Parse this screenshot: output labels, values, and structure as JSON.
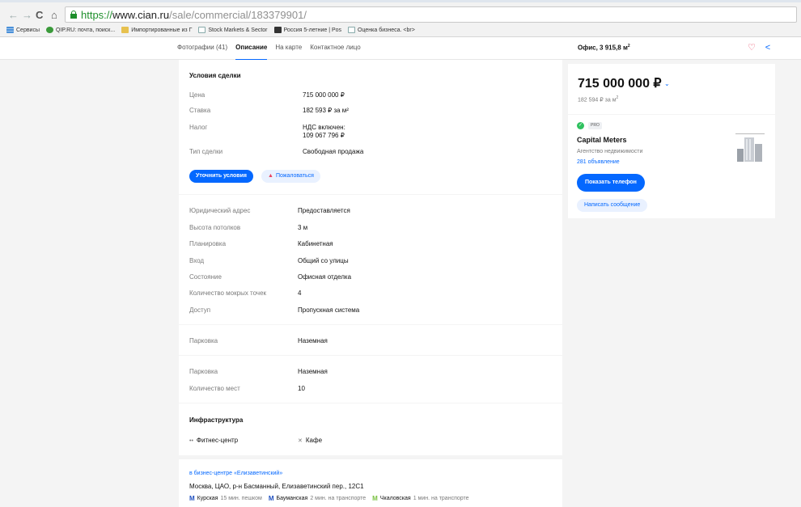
{
  "browser": {
    "url_protocol": "https://",
    "url_host": "www.cian.ru",
    "url_path": "/sale/commercial/183379901/",
    "bookmarks": [
      {
        "label": "Сервисы",
        "icon": "apps-icon"
      },
      {
        "label": "QIP.RU: почта, поиск...",
        "icon": "qip-icon"
      },
      {
        "label": "Импортированные из Г",
        "icon": "folder-icon"
      },
      {
        "label": "Stock Markets & Sector",
        "icon": "page-icon"
      },
      {
        "label": "Россия 5-летние | Pos",
        "icon": "ru-icon"
      },
      {
        "label": "Оценка бизнеса. <br>",
        "icon": "page-icon"
      }
    ]
  },
  "header": {
    "tabs": [
      "Фотографии (41)",
      "Описание",
      "На карте",
      "Контактное лицо"
    ],
    "active_tab_index": 1,
    "title": "Офис, 3 915,8 м",
    "title_sup": "2"
  },
  "conditions": {
    "title": "Условия сделки",
    "rows": [
      {
        "label": "Цена",
        "value": "715 000 000 ₽"
      },
      {
        "label": "Ставка",
        "value": "182 593 ₽ за м²"
      },
      {
        "label": "Налог",
        "value": "НДС включен:",
        "value2": "109 067 796 ₽"
      },
      {
        "label": "Тип сделки",
        "value": "Свободная продажа"
      }
    ],
    "clarify_button": "Уточнить условия",
    "complain_button": "Пожаловаться"
  },
  "params": [
    {
      "label": "Юридический адрес",
      "value": "Предоставляется"
    },
    {
      "label": "Высота потолков",
      "value": "3 м"
    },
    {
      "label": "Планировка",
      "value": "Кабинетная"
    },
    {
      "label": "Вход",
      "value": "Общий со улицы"
    },
    {
      "label": "Состояние",
      "value": "Офисная отделка"
    },
    {
      "label": "Количество мокрых точек",
      "value": "4"
    },
    {
      "label": "Доступ",
      "value": "Пропускная система"
    }
  ],
  "parking1": {
    "label": "Парковка",
    "value": "Наземная"
  },
  "parking2": [
    {
      "label": "Парковка",
      "value": "Наземная"
    },
    {
      "label": "Количество мест",
      "value": "10"
    }
  ],
  "infrastructure": {
    "title": "Инфраструктура",
    "items": [
      {
        "label": "Фитнес-центр",
        "icon": "dumbbell-icon"
      },
      {
        "label": "Кафе",
        "icon": "cutlery-icon"
      }
    ]
  },
  "address": {
    "business_center": "в бизнес-центре «Елизаветинский»",
    "line": "Москва, ЦАО, р-н Басманный, Елизаветинский пер., 12С1",
    "metro": [
      {
        "name": "Курская",
        "time": "15 мин. пешком",
        "color": "#1f4fbf"
      },
      {
        "name": "Бауманская",
        "time": "2 мин. на транспорте",
        "color": "#1f4fbf"
      },
      {
        "name": "Чкаловская",
        "time": "1 мин. на транспорте",
        "color": "#7ac142"
      }
    ]
  },
  "price_card": {
    "price": "715 000 000 ₽",
    "per_meter": "182 594 ₽ за м",
    "per_meter_sup": "2"
  },
  "agent": {
    "badge": "PRO",
    "name": "Capital Meters",
    "type": "Агентство недвижимости",
    "count": "281 объявление",
    "phone_button": "Показать телефон",
    "message_button": "Написать сообщение"
  },
  "colors": {
    "accent": "#0468ff",
    "favorite": "#e84260",
    "verified": "#2fc15f"
  }
}
